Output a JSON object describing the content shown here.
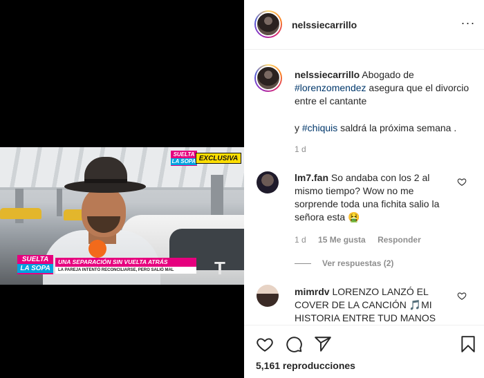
{
  "post": {
    "username": "nelssiecarrillo",
    "more_icon": "···",
    "caption": {
      "username": "nelssiecarrillo",
      "text_before": "Abogado de",
      "tag1": "#lorenzomendez",
      "text_mid": "asegura que el divorcio entre el cantante",
      "line2_prefix": "y",
      "tag2": "#chiquis",
      "line2_suffix": "saldrá la próxima semana ."
    },
    "caption_time": "1 d"
  },
  "video": {
    "badge_top": "SUELTA",
    "badge_top_sub": "LA SOPA",
    "badge_exclusive": "EXCLUSIVA",
    "logo_top": "SUELTA",
    "logo_bottom": "LA SOPA",
    "headline": "UNA SEPARACIÓN SIN VUELTA ATRÁS",
    "subheadline": "LA PAREJA INTENTÓ RECONCILIARSE, PERO SALIÓ MAL",
    "network_logo": "T"
  },
  "comments": [
    {
      "username": "lm7.fan",
      "text": "So andaba con los 2 al mismo tiempo? Wow no me sorprende toda una fichita salio la señora esta 🤮",
      "time": "1 d",
      "likes": "15 Me gusta",
      "reply_label": "Responder"
    },
    {
      "username": "mimrdv",
      "text": "LORENZO LANZÓ EL COVER DE LA CANCIÓN 🎵MI HISTORIA ENTRE TUD MANOS"
    }
  ],
  "view_replies": "Ver respuestas (2)",
  "actions": {
    "like_icon": "heart-icon",
    "comment_icon": "comment-icon",
    "share_icon": "share-icon",
    "save_icon": "bookmark-icon"
  },
  "views_text": "5,161 reproducciones"
}
